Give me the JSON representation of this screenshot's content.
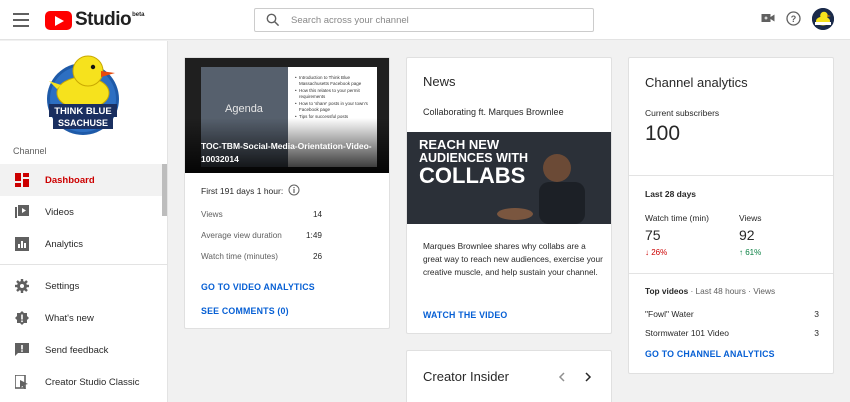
{
  "header": {
    "logo_text": "Studio",
    "logo_badge": "beta",
    "search_placeholder": "Search across your channel"
  },
  "sidebar": {
    "channel_label": "Channel",
    "channel_logo_text_1": "THINK BLUE",
    "channel_logo_text_2": "SSACHUSE",
    "items": [
      {
        "label": "Dashboard",
        "icon": "dashboard-icon",
        "active": true
      },
      {
        "label": "Videos",
        "icon": "videos-icon"
      },
      {
        "label": "Analytics",
        "icon": "analytics-icon"
      },
      {
        "label": "Settings",
        "icon": "gear-icon"
      },
      {
        "label": "What's new",
        "icon": "whats-new-icon"
      },
      {
        "label": "Send feedback",
        "icon": "feedback-icon"
      },
      {
        "label": "Creator Studio Classic",
        "icon": "classic-icon"
      }
    ]
  },
  "video_card": {
    "slide_title": "Agenda",
    "slide_bullets": [
      "Introduction to Think Blue Massachusetts Facebook page",
      "How this relates to your permit requirements",
      "How to 'share' posts in your town's Facebook page",
      "Tips for successful posts"
    ],
    "title": "TOC-TBM-Social-Media-Orientation-Video-10032014",
    "stats_heading": "First 191 days 1 hour:",
    "stats": [
      {
        "label": "Views",
        "value": "14"
      },
      {
        "label": "Average view duration",
        "value": "1:49"
      },
      {
        "label": "Watch time (minutes)",
        "value": "26"
      }
    ],
    "link_analytics": "GO TO VIDEO ANALYTICS",
    "link_comments": "SEE COMMENTS (0)"
  },
  "news_card": {
    "title": "News",
    "subtitle": "Collaborating ft. Marques Brownlee",
    "image_text": [
      "REACH NEW",
      "AUDIENCES WITH",
      "COLLABS"
    ],
    "body": "Marques Brownlee shares why collabs are a great way to reach new audiences, exercise your creative muscle, and help sustain your channel.",
    "link": "WATCH THE VIDEO"
  },
  "creator_insider": {
    "title": "Creator Insider"
  },
  "analytics_card": {
    "title": "Channel analytics",
    "subscribers_label": "Current subscribers",
    "subscribers_value": "100",
    "period_label": "Last 28 days",
    "watch_time_label": "Watch time (min)",
    "watch_time_value": "75",
    "watch_time_change": "26%",
    "views_label": "Views",
    "views_value": "92",
    "views_change": "61%",
    "top_videos_label": "Top videos",
    "top_videos_period": " · Last 48 hours · Views",
    "top_videos": [
      {
        "title": "\"Fowl\" Water",
        "views": "3"
      },
      {
        "title": "Stormwater 101 Video",
        "views": "3"
      }
    ],
    "link": "GO TO CHANNEL ANALYTICS"
  },
  "colors": {
    "accent_red": "#cc0000",
    "link_blue": "#065fd4",
    "up_green": "#0a8043"
  }
}
